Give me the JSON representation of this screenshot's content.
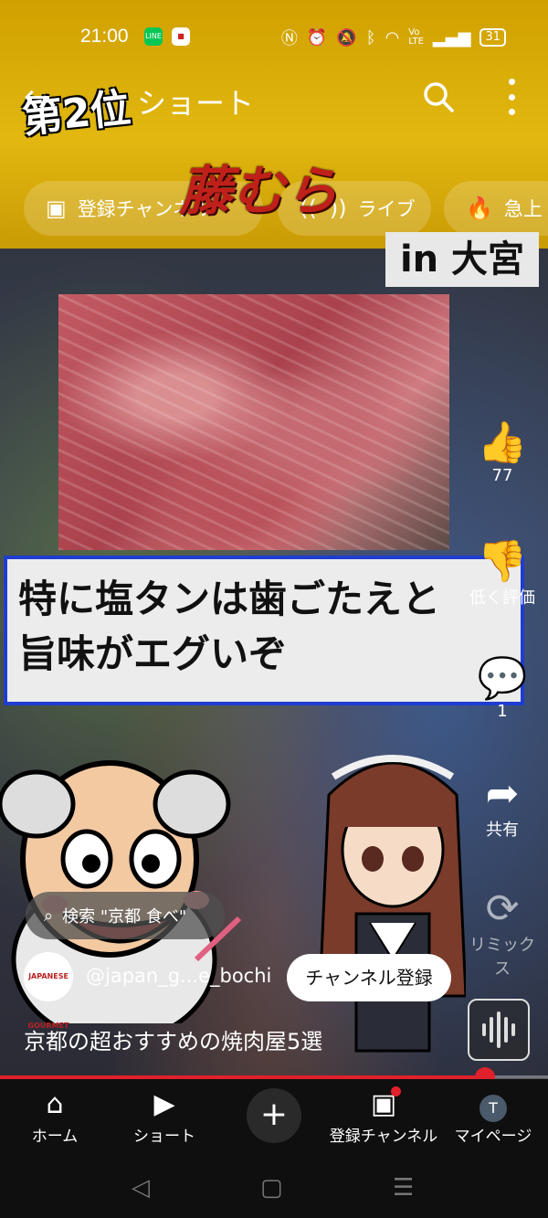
{
  "status_bar": {
    "time": "21:00",
    "app_icons": [
      "LINE",
      "app"
    ],
    "system_icons": [
      "nfc-icon",
      "alarm-icon",
      "mute-icon",
      "bluetooth-icon",
      "wifi-icon",
      "volte-icon",
      "signal-icon"
    ],
    "volte_label": "Vo\nLTE",
    "battery": "31"
  },
  "top_bar": {
    "title": "ショート"
  },
  "chips": [
    {
      "label": "登録チャンネル",
      "icon": "subscriptions-icon"
    },
    {
      "label": "ライブ",
      "icon": "live-icon"
    },
    {
      "label": "急上",
      "icon": "trending-icon"
    }
  ],
  "video_overlay": {
    "rank": "第2位",
    "shop_name": "藤むら",
    "location": "in 大宮",
    "caption_line1": "特に塩タンは歯ごたえと",
    "caption_line2": "旨味がエグいぞ"
  },
  "actions": {
    "like_label": "77",
    "dislike_label": "低く評価",
    "comments_label": "1",
    "share_label": "共有",
    "remix_label": "リミックス"
  },
  "search_pill": {
    "text": "検索 \"京都 食べ\""
  },
  "channel": {
    "avatar_text": "JAPANESE GOURMET",
    "handle": "@japan_g...e_bochi",
    "subscribe_label": "チャンネル登録"
  },
  "video_title": "京都の超おすすめの焼肉屋5選",
  "progress": 0.885,
  "bottom_nav": {
    "home": "ホーム",
    "shorts": "ショート",
    "subscriptions": "登録チャンネル",
    "you": "マイページ",
    "you_avatar_letter": "T"
  },
  "colors": {
    "accent_red": "#e0202a",
    "banner_yellow": "#e2b810",
    "caption_border": "#1f3dd0"
  }
}
